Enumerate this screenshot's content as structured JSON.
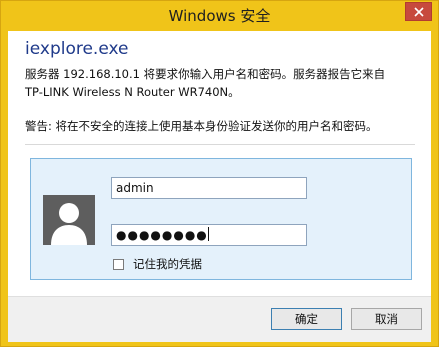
{
  "window": {
    "title": "Windows 安全",
    "close_icon": "close-icon"
  },
  "dialog": {
    "app_name": "iexplore.exe",
    "message_line1": "服务器 192.168.10.1 将要求你输入用户名和密码。服务器报告它来自",
    "message_line2": "TP-LINK Wireless N Router WR740N。",
    "warning": "警告: 将在不安全的连接上使用基本身份验证发送你的用户名和密码。"
  },
  "credentials": {
    "avatar_icon": "user-avatar-icon",
    "username": "admin",
    "password_masked": "●●●●●●●●",
    "remember_label": "记住我的凭据",
    "remember_checked": false
  },
  "buttons": {
    "ok": "确定",
    "cancel": "取消"
  },
  "colors": {
    "title_bar": "#f0c419",
    "app_name": "#1f3a8a",
    "panel_bg": "#e4f1fb",
    "panel_border": "#7fb6de",
    "close_button": "#c74a3d"
  }
}
